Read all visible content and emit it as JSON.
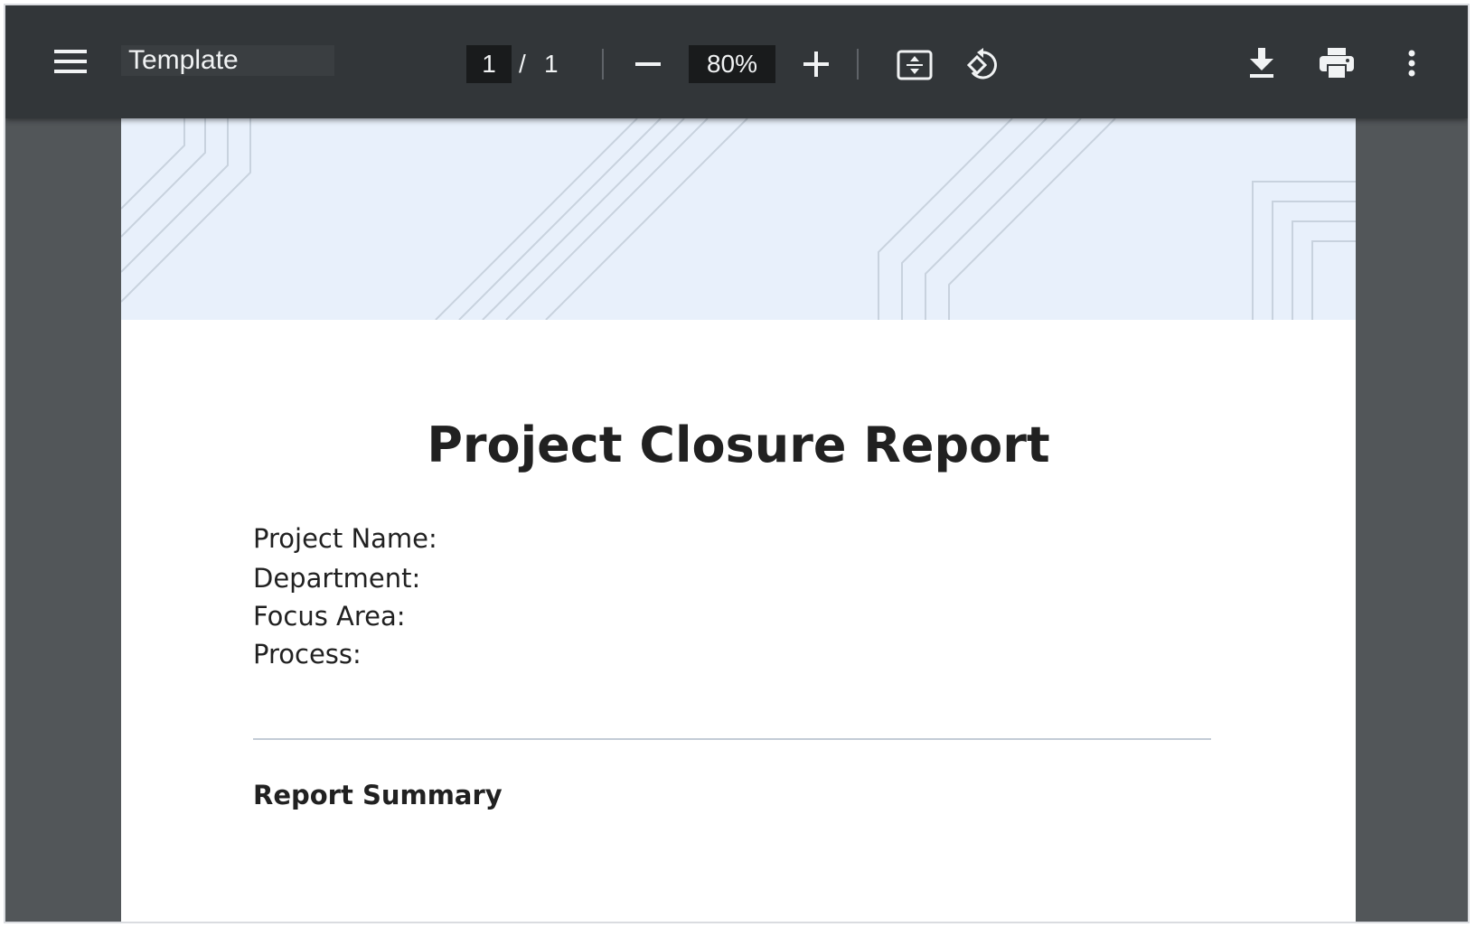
{
  "toolbar": {
    "menu_icon": "hamburger-menu-icon",
    "title": "Template",
    "page_current": "1",
    "page_separator": "/",
    "page_total": "1",
    "zoom_out_icon": "minus-icon",
    "zoom_level": "80%",
    "zoom_in_icon": "plus-icon",
    "fit_icon": "fit-to-page-icon",
    "rotate_icon": "rotate-counterclockwise-icon",
    "download_icon": "download-icon",
    "print_icon": "printer-icon",
    "more_icon": "more-vertical-icon"
  },
  "document": {
    "title": "Project Closure Report",
    "fields": [
      "Project Name:",
      "Department:",
      "Focus Area:",
      "Process:"
    ],
    "section_heading": "Report Summary"
  },
  "colors": {
    "toolbar_bg": "#323639",
    "viewer_bg": "#525659",
    "banner_bg": "#e8f0fb",
    "banner_lines": "#c8d2de",
    "text": "#212121"
  }
}
